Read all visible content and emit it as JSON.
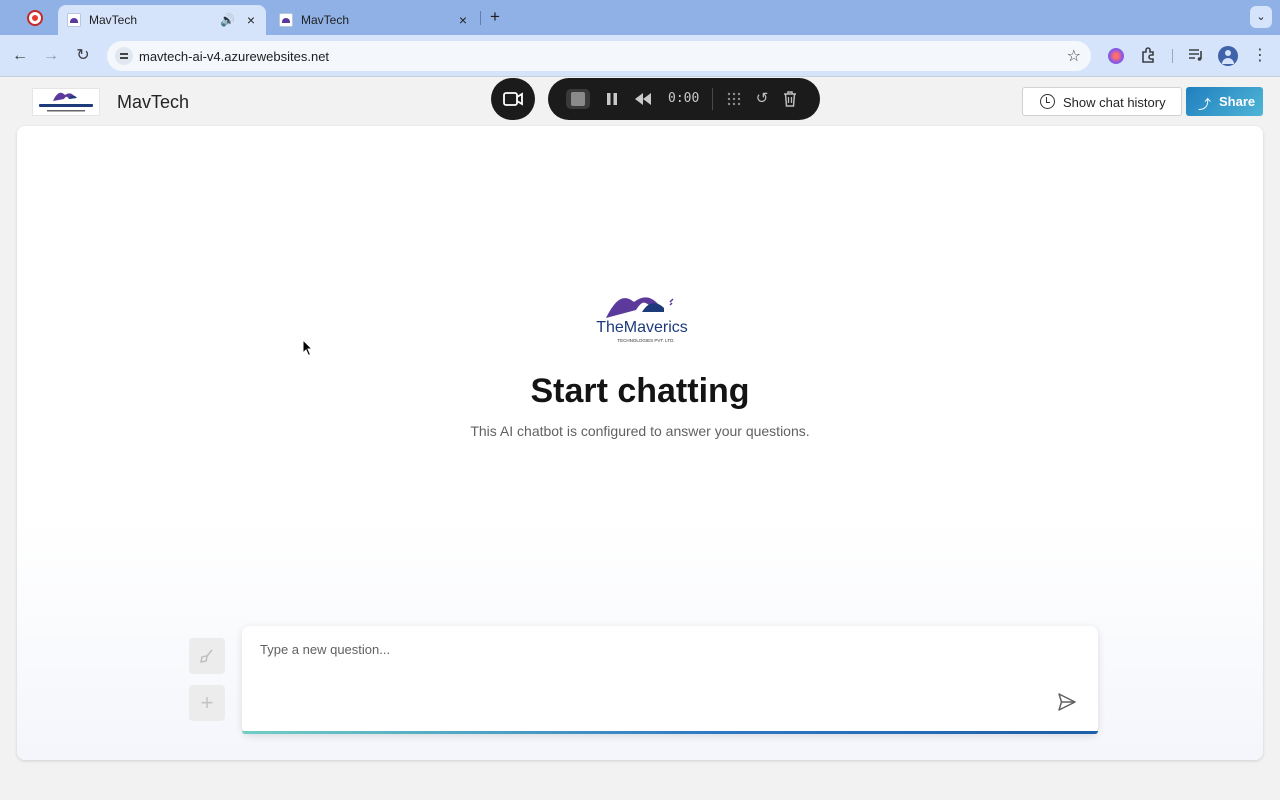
{
  "browser": {
    "tabs": [
      {
        "title": "MavTech",
        "active": true,
        "audio": true
      },
      {
        "title": "MavTech",
        "active": false,
        "audio": false
      }
    ],
    "address_bar": {
      "url": "mavtech-ai-v4.azurewebsites.net"
    }
  },
  "recorder": {
    "time": "0:00"
  },
  "app": {
    "title": "MavTech",
    "logo_text": "TheMaverics",
    "logo_subtext": "TECHNOLOGIES PVT. LTD.",
    "header_buttons": {
      "history_label": "Show chat history",
      "share_label": "Share"
    }
  },
  "chat": {
    "empty_state": {
      "title": "Start chatting",
      "subtitle": "This AI chatbot is configured to answer your questions."
    },
    "input": {
      "placeholder": "Type a new question...",
      "value": ""
    }
  },
  "colors": {
    "tab_strip": "#8fb1e6",
    "toolbar": "#d6e4fb",
    "logo_purple": "#5b3a9b",
    "logo_navy": "#1d3a7a",
    "share_accent": "#1f7fbf",
    "underline_accent": "#2f78c4"
  }
}
